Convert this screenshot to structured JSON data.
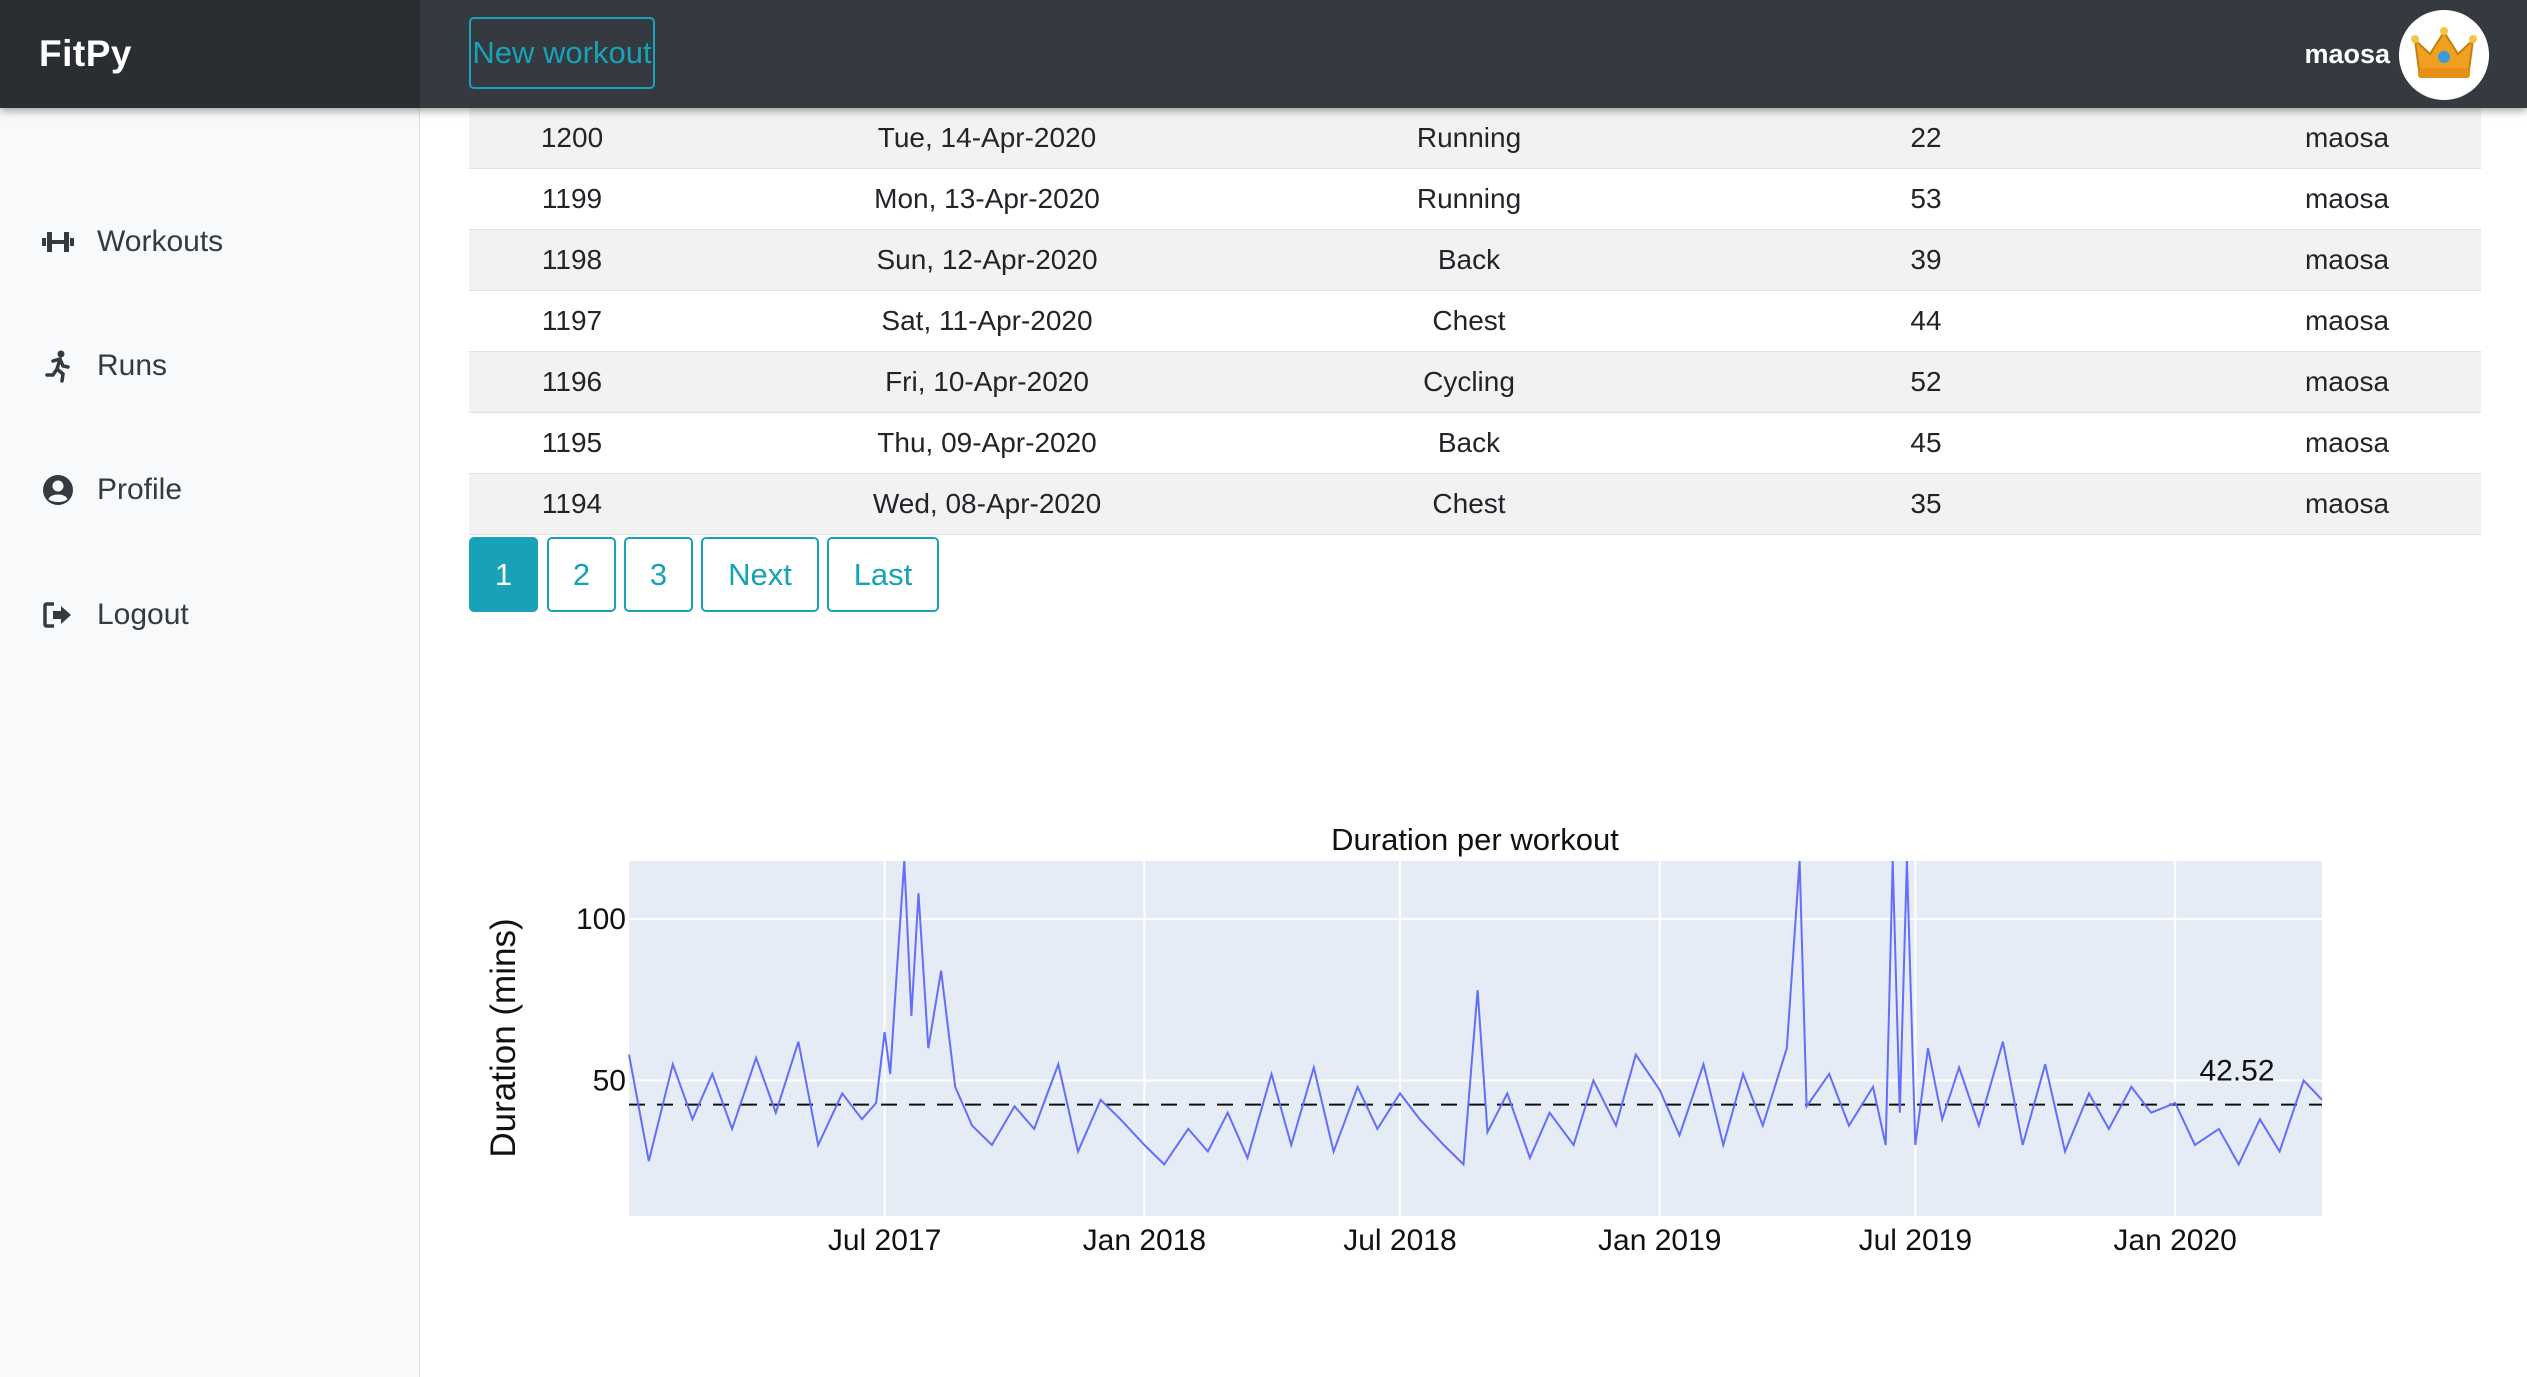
{
  "app": {
    "brand": "FitPy",
    "new_workout_label": "New workout"
  },
  "user": {
    "name": "maosa",
    "avatar_icon": "crown-avatar-icon"
  },
  "sidebar": {
    "items": [
      {
        "label": "Workouts",
        "icon": "dumbbell-icon"
      },
      {
        "label": "Runs",
        "icon": "running-icon"
      },
      {
        "label": "Profile",
        "icon": "user-circle-icon"
      },
      {
        "label": "Logout",
        "icon": "sign-out-icon"
      }
    ]
  },
  "table": {
    "rows": [
      {
        "id": "1200",
        "date": "Tue, 14-Apr-2020",
        "type": "Running",
        "duration": "22",
        "user": "maosa"
      },
      {
        "id": "1199",
        "date": "Mon, 13-Apr-2020",
        "type": "Running",
        "duration": "53",
        "user": "maosa"
      },
      {
        "id": "1198",
        "date": "Sun, 12-Apr-2020",
        "type": "Back",
        "duration": "39",
        "user": "maosa"
      },
      {
        "id": "1197",
        "date": "Sat, 11-Apr-2020",
        "type": "Chest",
        "duration": "44",
        "user": "maosa"
      },
      {
        "id": "1196",
        "date": "Fri, 10-Apr-2020",
        "type": "Cycling",
        "duration": "52",
        "user": "maosa"
      },
      {
        "id": "1195",
        "date": "Thu, 09-Apr-2020",
        "type": "Back",
        "duration": "45",
        "user": "maosa"
      },
      {
        "id": "1194",
        "date": "Wed, 08-Apr-2020",
        "type": "Chest",
        "duration": "35",
        "user": "maosa"
      }
    ]
  },
  "pagination": {
    "pages": [
      "1",
      "2",
      "3"
    ],
    "active": "1",
    "next_label": "Next",
    "last_label": "Last"
  },
  "colors": {
    "accent": "#17a2b8",
    "navbar": "#343a40",
    "series": "#636efa",
    "plot_bg": "#e5ecf6"
  },
  "chart_data": {
    "type": "line",
    "title": "Duration per workout",
    "ylabel": "Duration (mins)",
    "xlabel": "",
    "x_range": [
      "2017-01-01",
      "2020-04-14"
    ],
    "ylim": [
      8,
      118
    ],
    "x_ticks": [
      {
        "date": "2017-07-01",
        "label": "Jul 2017"
      },
      {
        "date": "2018-01-01",
        "label": "Jan 2018"
      },
      {
        "date": "2018-07-01",
        "label": "Jul 2018"
      },
      {
        "date": "2019-01-01",
        "label": "Jan 2019"
      },
      {
        "date": "2019-07-01",
        "label": "Jul 2019"
      },
      {
        "date": "2020-01-01",
        "label": "Jan 2020"
      }
    ],
    "y_ticks": [
      50,
      100
    ],
    "mean_line": {
      "value": 42.52,
      "label": "42.52",
      "style": "dashed"
    },
    "grid": true,
    "series": [
      {
        "x": [
          "2017-01-01",
          "2017-01-15",
          "2017-02-01",
          "2017-02-15",
          "2017-03-01",
          "2017-03-15",
          "2017-04-01",
          "2017-04-15",
          "2017-05-01",
          "2017-05-15",
          "2017-06-01",
          "2017-06-15",
          "2017-06-25",
          "2017-07-01",
          "2017-07-05",
          "2017-07-10",
          "2017-07-15",
          "2017-07-20",
          "2017-07-25",
          "2017-08-01",
          "2017-08-10",
          "2017-08-20",
          "2017-09-01",
          "2017-09-15",
          "2017-10-01",
          "2017-10-15",
          "2017-11-01",
          "2017-11-15",
          "2017-12-01",
          "2017-12-15",
          "2018-01-01",
          "2018-01-15",
          "2018-02-01",
          "2018-02-15",
          "2018-03-01",
          "2018-03-15",
          "2018-04-01",
          "2018-04-15",
          "2018-05-01",
          "2018-05-15",
          "2018-06-01",
          "2018-06-15",
          "2018-07-01",
          "2018-07-15",
          "2018-08-01",
          "2018-08-15",
          "2018-08-25",
          "2018-09-01",
          "2018-09-15",
          "2018-10-01",
          "2018-10-15",
          "2018-11-01",
          "2018-11-15",
          "2018-12-01",
          "2018-12-15",
          "2019-01-01",
          "2019-01-15",
          "2019-02-01",
          "2019-02-15",
          "2019-03-01",
          "2019-03-15",
          "2019-04-01",
          "2019-04-10",
          "2019-04-15",
          "2019-05-01",
          "2019-05-15",
          "2019-06-01",
          "2019-06-10",
          "2019-06-15",
          "2019-06-20",
          "2019-06-25",
          "2019-07-01",
          "2019-07-10",
          "2019-07-20",
          "2019-08-01",
          "2019-08-15",
          "2019-09-01",
          "2019-09-15",
          "2019-10-01",
          "2019-10-15",
          "2019-11-01",
          "2019-11-15",
          "2019-12-01",
          "2019-12-15",
          "2020-01-01",
          "2020-01-15",
          "2020-02-01",
          "2020-02-15",
          "2020-03-01",
          "2020-03-15",
          "2020-04-01",
          "2020-04-14"
        ],
        "y": [
          58,
          25,
          55,
          38,
          52,
          35,
          57,
          40,
          62,
          30,
          46,
          38,
          43,
          65,
          52,
          86,
          118,
          70,
          108,
          60,
          84,
          48,
          36,
          30,
          42,
          35,
          55,
          28,
          44,
          38,
          30,
          24,
          35,
          28,
          40,
          26,
          52,
          30,
          54,
          28,
          48,
          35,
          46,
          38,
          30,
          24,
          78,
          34,
          46,
          26,
          40,
          30,
          50,
          36,
          58,
          47,
          33,
          55,
          30,
          52,
          36,
          60,
          118,
          42,
          52,
          36,
          48,
          30,
          118,
          40,
          118,
          30,
          60,
          38,
          54,
          36,
          62,
          30,
          55,
          28,
          46,
          35,
          48,
          40,
          43,
          30,
          35,
          24,
          38,
          28,
          50,
          44
        ]
      }
    ]
  }
}
